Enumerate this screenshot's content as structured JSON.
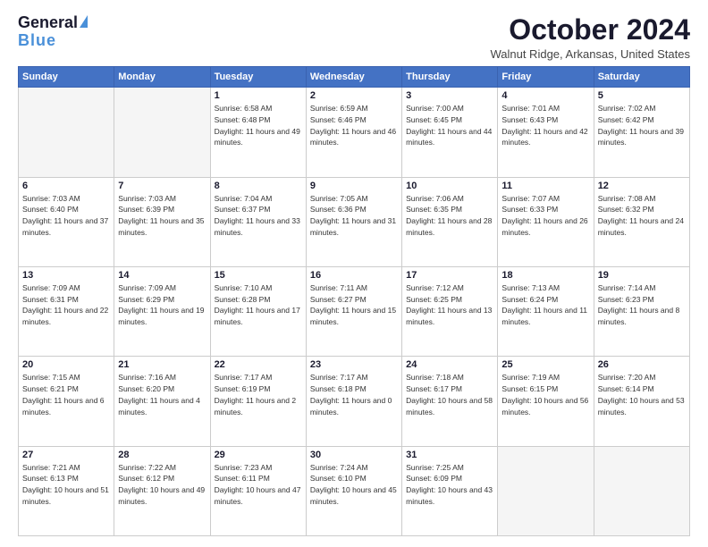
{
  "logo": {
    "line1": "General",
    "line2": "Blue"
  },
  "header": {
    "title": "October 2024",
    "location": "Walnut Ridge, Arkansas, United States"
  },
  "weekdays": [
    "Sunday",
    "Monday",
    "Tuesday",
    "Wednesday",
    "Thursday",
    "Friday",
    "Saturday"
  ],
  "weeks": [
    [
      {
        "day": "",
        "detail": ""
      },
      {
        "day": "",
        "detail": ""
      },
      {
        "day": "1",
        "detail": "Sunrise: 6:58 AM\nSunset: 6:48 PM\nDaylight: 11 hours and 49 minutes."
      },
      {
        "day": "2",
        "detail": "Sunrise: 6:59 AM\nSunset: 6:46 PM\nDaylight: 11 hours and 46 minutes."
      },
      {
        "day": "3",
        "detail": "Sunrise: 7:00 AM\nSunset: 6:45 PM\nDaylight: 11 hours and 44 minutes."
      },
      {
        "day": "4",
        "detail": "Sunrise: 7:01 AM\nSunset: 6:43 PM\nDaylight: 11 hours and 42 minutes."
      },
      {
        "day": "5",
        "detail": "Sunrise: 7:02 AM\nSunset: 6:42 PM\nDaylight: 11 hours and 39 minutes."
      }
    ],
    [
      {
        "day": "6",
        "detail": "Sunrise: 7:03 AM\nSunset: 6:40 PM\nDaylight: 11 hours and 37 minutes."
      },
      {
        "day": "7",
        "detail": "Sunrise: 7:03 AM\nSunset: 6:39 PM\nDaylight: 11 hours and 35 minutes."
      },
      {
        "day": "8",
        "detail": "Sunrise: 7:04 AM\nSunset: 6:37 PM\nDaylight: 11 hours and 33 minutes."
      },
      {
        "day": "9",
        "detail": "Sunrise: 7:05 AM\nSunset: 6:36 PM\nDaylight: 11 hours and 31 minutes."
      },
      {
        "day": "10",
        "detail": "Sunrise: 7:06 AM\nSunset: 6:35 PM\nDaylight: 11 hours and 28 minutes."
      },
      {
        "day": "11",
        "detail": "Sunrise: 7:07 AM\nSunset: 6:33 PM\nDaylight: 11 hours and 26 minutes."
      },
      {
        "day": "12",
        "detail": "Sunrise: 7:08 AM\nSunset: 6:32 PM\nDaylight: 11 hours and 24 minutes."
      }
    ],
    [
      {
        "day": "13",
        "detail": "Sunrise: 7:09 AM\nSunset: 6:31 PM\nDaylight: 11 hours and 22 minutes."
      },
      {
        "day": "14",
        "detail": "Sunrise: 7:09 AM\nSunset: 6:29 PM\nDaylight: 11 hours and 19 minutes."
      },
      {
        "day": "15",
        "detail": "Sunrise: 7:10 AM\nSunset: 6:28 PM\nDaylight: 11 hours and 17 minutes."
      },
      {
        "day": "16",
        "detail": "Sunrise: 7:11 AM\nSunset: 6:27 PM\nDaylight: 11 hours and 15 minutes."
      },
      {
        "day": "17",
        "detail": "Sunrise: 7:12 AM\nSunset: 6:25 PM\nDaylight: 11 hours and 13 minutes."
      },
      {
        "day": "18",
        "detail": "Sunrise: 7:13 AM\nSunset: 6:24 PM\nDaylight: 11 hours and 11 minutes."
      },
      {
        "day": "19",
        "detail": "Sunrise: 7:14 AM\nSunset: 6:23 PM\nDaylight: 11 hours and 8 minutes."
      }
    ],
    [
      {
        "day": "20",
        "detail": "Sunrise: 7:15 AM\nSunset: 6:21 PM\nDaylight: 11 hours and 6 minutes."
      },
      {
        "day": "21",
        "detail": "Sunrise: 7:16 AM\nSunset: 6:20 PM\nDaylight: 11 hours and 4 minutes."
      },
      {
        "day": "22",
        "detail": "Sunrise: 7:17 AM\nSunset: 6:19 PM\nDaylight: 11 hours and 2 minutes."
      },
      {
        "day": "23",
        "detail": "Sunrise: 7:17 AM\nSunset: 6:18 PM\nDaylight: 11 hours and 0 minutes."
      },
      {
        "day": "24",
        "detail": "Sunrise: 7:18 AM\nSunset: 6:17 PM\nDaylight: 10 hours and 58 minutes."
      },
      {
        "day": "25",
        "detail": "Sunrise: 7:19 AM\nSunset: 6:15 PM\nDaylight: 10 hours and 56 minutes."
      },
      {
        "day": "26",
        "detail": "Sunrise: 7:20 AM\nSunset: 6:14 PM\nDaylight: 10 hours and 53 minutes."
      }
    ],
    [
      {
        "day": "27",
        "detail": "Sunrise: 7:21 AM\nSunset: 6:13 PM\nDaylight: 10 hours and 51 minutes."
      },
      {
        "day": "28",
        "detail": "Sunrise: 7:22 AM\nSunset: 6:12 PM\nDaylight: 10 hours and 49 minutes."
      },
      {
        "day": "29",
        "detail": "Sunrise: 7:23 AM\nSunset: 6:11 PM\nDaylight: 10 hours and 47 minutes."
      },
      {
        "day": "30",
        "detail": "Sunrise: 7:24 AM\nSunset: 6:10 PM\nDaylight: 10 hours and 45 minutes."
      },
      {
        "day": "31",
        "detail": "Sunrise: 7:25 AM\nSunset: 6:09 PM\nDaylight: 10 hours and 43 minutes."
      },
      {
        "day": "",
        "detail": ""
      },
      {
        "day": "",
        "detail": ""
      }
    ]
  ]
}
